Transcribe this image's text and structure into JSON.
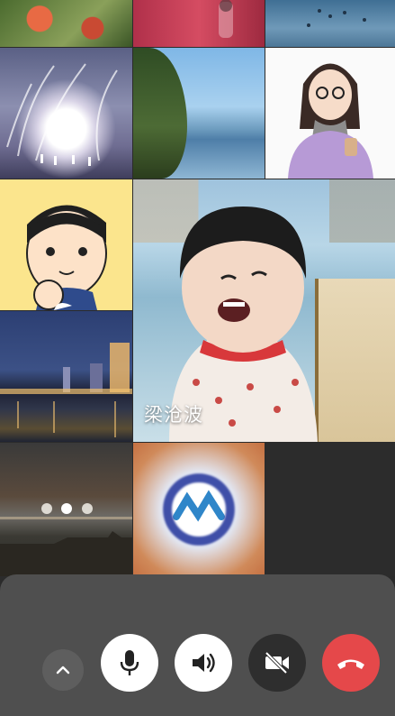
{
  "participants": [
    {
      "name": "",
      "tile": "flowers"
    },
    {
      "name": "",
      "tile": "red"
    },
    {
      "name": "",
      "tile": "blue"
    },
    {
      "name": "",
      "tile": "painting"
    },
    {
      "name": "",
      "tile": "lake"
    },
    {
      "name": "",
      "tile": "cartoon-girl"
    },
    {
      "name": "",
      "tile": "cartoon-man"
    },
    {
      "name": "梁沧波",
      "tile": "main-speaker"
    },
    {
      "name": "",
      "tile": "city-night"
    },
    {
      "name": "",
      "tile": "sunset"
    },
    {
      "name": "",
      "tile": "logo"
    }
  ],
  "main_speaker": {
    "name": "梁沧波"
  },
  "controls": {
    "collapse_icon": "chevron-up-icon",
    "mic_icon": "microphone-icon",
    "speaker_icon": "speaker-icon",
    "camera_icon": "camera-off-icon",
    "hangup_icon": "hangup-icon"
  },
  "colors": {
    "panel": "#4f4f4f",
    "hangup": "#e5484a",
    "camera_off": "#2e2e2e",
    "button_light": "#ffffff"
  }
}
